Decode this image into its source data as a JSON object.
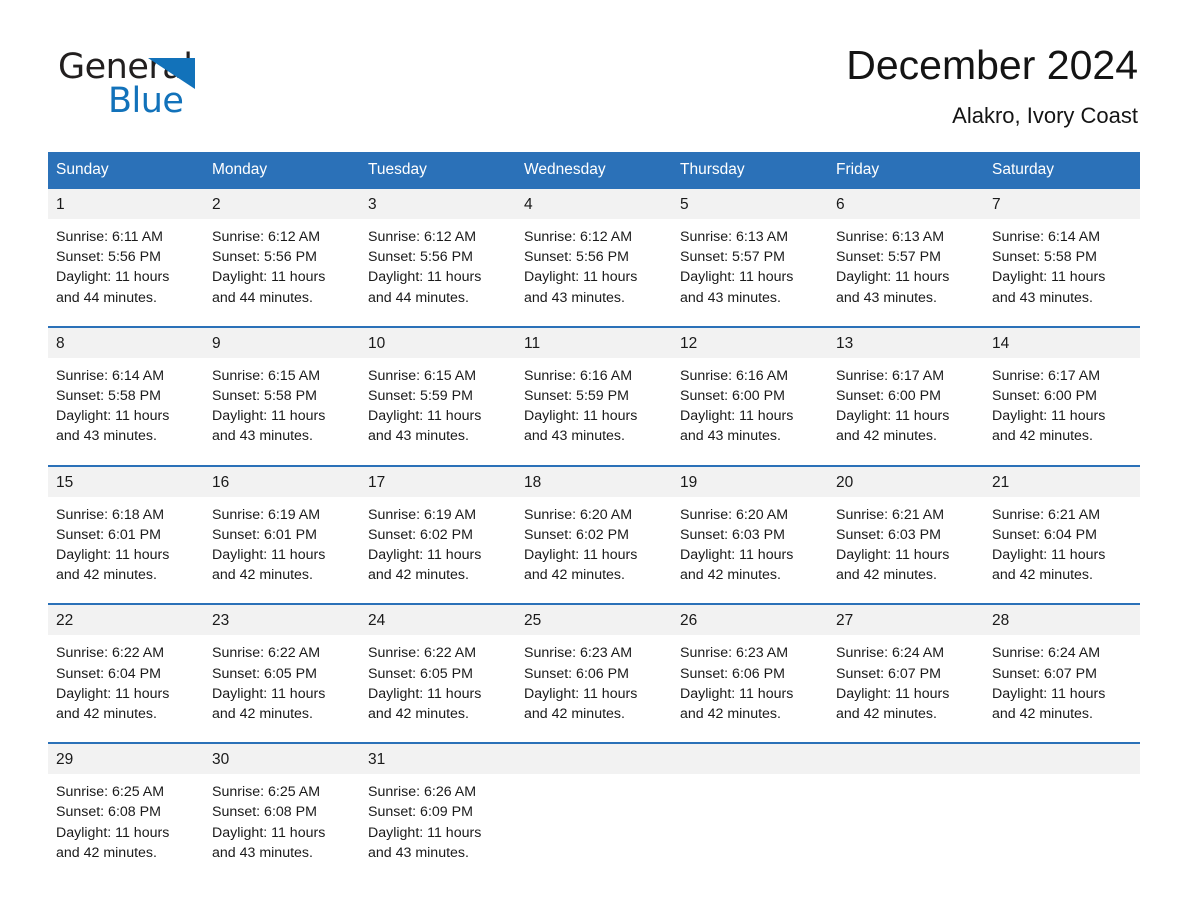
{
  "brand": {
    "name_top": "General",
    "name_bottom": "Blue",
    "triangle_color": "#1272ba",
    "accent_color": "#2b71b8"
  },
  "header": {
    "title": "December 2024",
    "location": "Alakro, Ivory Coast"
  },
  "calendar": {
    "weekday_headers": [
      "Sunday",
      "Monday",
      "Tuesday",
      "Wednesday",
      "Thursday",
      "Friday",
      "Saturday"
    ],
    "weeks": [
      [
        {
          "day": "1",
          "sunrise": "Sunrise: 6:11 AM",
          "sunset": "Sunset: 5:56 PM",
          "daylight_1": "Daylight: 11 hours",
          "daylight_2": "and 44 minutes."
        },
        {
          "day": "2",
          "sunrise": "Sunrise: 6:12 AM",
          "sunset": "Sunset: 5:56 PM",
          "daylight_1": "Daylight: 11 hours",
          "daylight_2": "and 44 minutes."
        },
        {
          "day": "3",
          "sunrise": "Sunrise: 6:12 AM",
          "sunset": "Sunset: 5:56 PM",
          "daylight_1": "Daylight: 11 hours",
          "daylight_2": "and 44 minutes."
        },
        {
          "day": "4",
          "sunrise": "Sunrise: 6:12 AM",
          "sunset": "Sunset: 5:56 PM",
          "daylight_1": "Daylight: 11 hours",
          "daylight_2": "and 43 minutes."
        },
        {
          "day": "5",
          "sunrise": "Sunrise: 6:13 AM",
          "sunset": "Sunset: 5:57 PM",
          "daylight_1": "Daylight: 11 hours",
          "daylight_2": "and 43 minutes."
        },
        {
          "day": "6",
          "sunrise": "Sunrise: 6:13 AM",
          "sunset": "Sunset: 5:57 PM",
          "daylight_1": "Daylight: 11 hours",
          "daylight_2": "and 43 minutes."
        },
        {
          "day": "7",
          "sunrise": "Sunrise: 6:14 AM",
          "sunset": "Sunset: 5:58 PM",
          "daylight_1": "Daylight: 11 hours",
          "daylight_2": "and 43 minutes."
        }
      ],
      [
        {
          "day": "8",
          "sunrise": "Sunrise: 6:14 AM",
          "sunset": "Sunset: 5:58 PM",
          "daylight_1": "Daylight: 11 hours",
          "daylight_2": "and 43 minutes."
        },
        {
          "day": "9",
          "sunrise": "Sunrise: 6:15 AM",
          "sunset": "Sunset: 5:58 PM",
          "daylight_1": "Daylight: 11 hours",
          "daylight_2": "and 43 minutes."
        },
        {
          "day": "10",
          "sunrise": "Sunrise: 6:15 AM",
          "sunset": "Sunset: 5:59 PM",
          "daylight_1": "Daylight: 11 hours",
          "daylight_2": "and 43 minutes."
        },
        {
          "day": "11",
          "sunrise": "Sunrise: 6:16 AM",
          "sunset": "Sunset: 5:59 PM",
          "daylight_1": "Daylight: 11 hours",
          "daylight_2": "and 43 minutes."
        },
        {
          "day": "12",
          "sunrise": "Sunrise: 6:16 AM",
          "sunset": "Sunset: 6:00 PM",
          "daylight_1": "Daylight: 11 hours",
          "daylight_2": "and 43 minutes."
        },
        {
          "day": "13",
          "sunrise": "Sunrise: 6:17 AM",
          "sunset": "Sunset: 6:00 PM",
          "daylight_1": "Daylight: 11 hours",
          "daylight_2": "and 42 minutes."
        },
        {
          "day": "14",
          "sunrise": "Sunrise: 6:17 AM",
          "sunset": "Sunset: 6:00 PM",
          "daylight_1": "Daylight: 11 hours",
          "daylight_2": "and 42 minutes."
        }
      ],
      [
        {
          "day": "15",
          "sunrise": "Sunrise: 6:18 AM",
          "sunset": "Sunset: 6:01 PM",
          "daylight_1": "Daylight: 11 hours",
          "daylight_2": "and 42 minutes."
        },
        {
          "day": "16",
          "sunrise": "Sunrise: 6:19 AM",
          "sunset": "Sunset: 6:01 PM",
          "daylight_1": "Daylight: 11 hours",
          "daylight_2": "and 42 minutes."
        },
        {
          "day": "17",
          "sunrise": "Sunrise: 6:19 AM",
          "sunset": "Sunset: 6:02 PM",
          "daylight_1": "Daylight: 11 hours",
          "daylight_2": "and 42 minutes."
        },
        {
          "day": "18",
          "sunrise": "Sunrise: 6:20 AM",
          "sunset": "Sunset: 6:02 PM",
          "daylight_1": "Daylight: 11 hours",
          "daylight_2": "and 42 minutes."
        },
        {
          "day": "19",
          "sunrise": "Sunrise: 6:20 AM",
          "sunset": "Sunset: 6:03 PM",
          "daylight_1": "Daylight: 11 hours",
          "daylight_2": "and 42 minutes."
        },
        {
          "day": "20",
          "sunrise": "Sunrise: 6:21 AM",
          "sunset": "Sunset: 6:03 PM",
          "daylight_1": "Daylight: 11 hours",
          "daylight_2": "and 42 minutes."
        },
        {
          "day": "21",
          "sunrise": "Sunrise: 6:21 AM",
          "sunset": "Sunset: 6:04 PM",
          "daylight_1": "Daylight: 11 hours",
          "daylight_2": "and 42 minutes."
        }
      ],
      [
        {
          "day": "22",
          "sunrise": "Sunrise: 6:22 AM",
          "sunset": "Sunset: 6:04 PM",
          "daylight_1": "Daylight: 11 hours",
          "daylight_2": "and 42 minutes."
        },
        {
          "day": "23",
          "sunrise": "Sunrise: 6:22 AM",
          "sunset": "Sunset: 6:05 PM",
          "daylight_1": "Daylight: 11 hours",
          "daylight_2": "and 42 minutes."
        },
        {
          "day": "24",
          "sunrise": "Sunrise: 6:22 AM",
          "sunset": "Sunset: 6:05 PM",
          "daylight_1": "Daylight: 11 hours",
          "daylight_2": "and 42 minutes."
        },
        {
          "day": "25",
          "sunrise": "Sunrise: 6:23 AM",
          "sunset": "Sunset: 6:06 PM",
          "daylight_1": "Daylight: 11 hours",
          "daylight_2": "and 42 minutes."
        },
        {
          "day": "26",
          "sunrise": "Sunrise: 6:23 AM",
          "sunset": "Sunset: 6:06 PM",
          "daylight_1": "Daylight: 11 hours",
          "daylight_2": "and 42 minutes."
        },
        {
          "day": "27",
          "sunrise": "Sunrise: 6:24 AM",
          "sunset": "Sunset: 6:07 PM",
          "daylight_1": "Daylight: 11 hours",
          "daylight_2": "and 42 minutes."
        },
        {
          "day": "28",
          "sunrise": "Sunrise: 6:24 AM",
          "sunset": "Sunset: 6:07 PM",
          "daylight_1": "Daylight: 11 hours",
          "daylight_2": "and 42 minutes."
        }
      ],
      [
        {
          "day": "29",
          "sunrise": "Sunrise: 6:25 AM",
          "sunset": "Sunset: 6:08 PM",
          "daylight_1": "Daylight: 11 hours",
          "daylight_2": "and 42 minutes."
        },
        {
          "day": "30",
          "sunrise": "Sunrise: 6:25 AM",
          "sunset": "Sunset: 6:08 PM",
          "daylight_1": "Daylight: 11 hours",
          "daylight_2": "and 43 minutes."
        },
        {
          "day": "31",
          "sunrise": "Sunrise: 6:26 AM",
          "sunset": "Sunset: 6:09 PM",
          "daylight_1": "Daylight: 11 hours",
          "daylight_2": "and 43 minutes."
        },
        {
          "day": "",
          "sunrise": "",
          "sunset": "",
          "daylight_1": "",
          "daylight_2": ""
        },
        {
          "day": "",
          "sunrise": "",
          "sunset": "",
          "daylight_1": "",
          "daylight_2": ""
        },
        {
          "day": "",
          "sunrise": "",
          "sunset": "",
          "daylight_1": "",
          "daylight_2": ""
        },
        {
          "day": "",
          "sunrise": "",
          "sunset": "",
          "daylight_1": "",
          "daylight_2": ""
        }
      ]
    ]
  }
}
